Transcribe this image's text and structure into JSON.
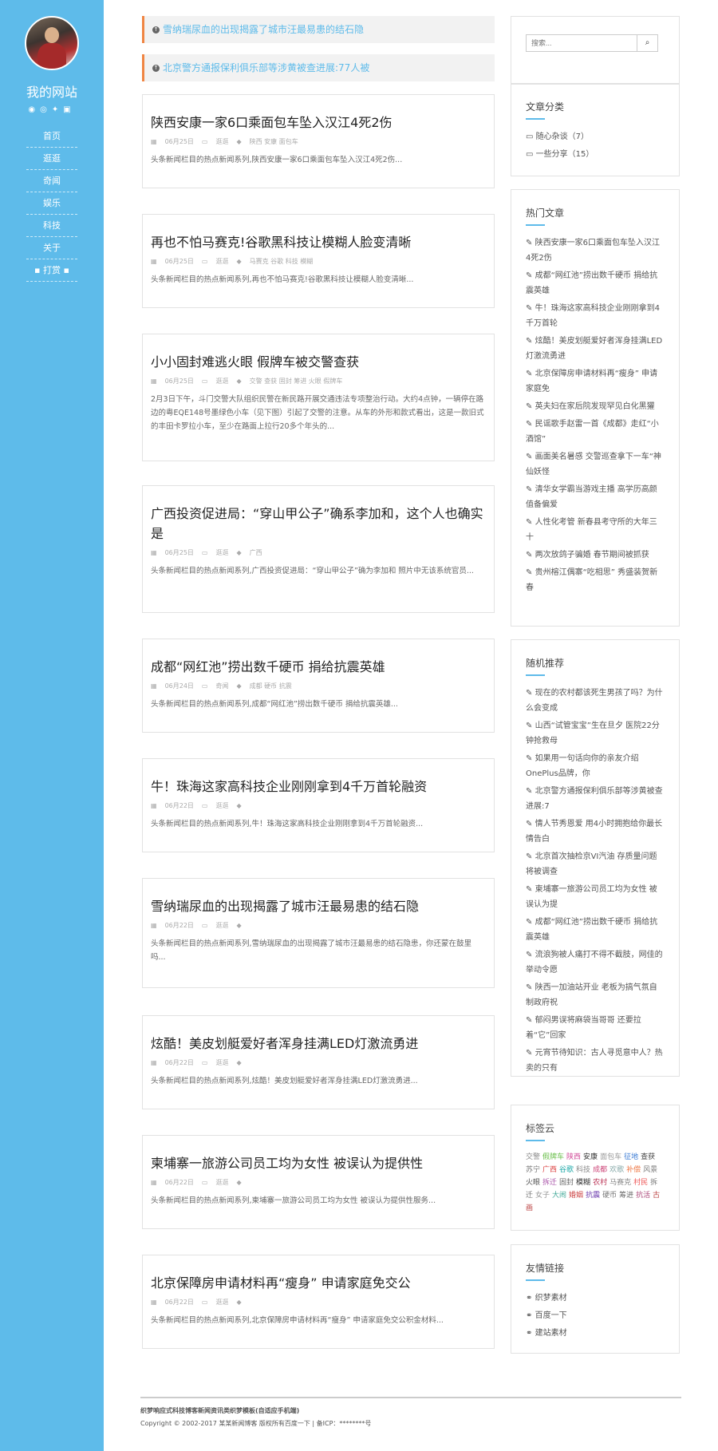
{
  "site": {
    "title": "我的网站",
    "social_icons": [
      "rss-icon",
      "weibo-icon",
      "twitter-icon",
      "facebook-icon"
    ],
    "nav": [
      "首页",
      "逛逛",
      "奇闻",
      "娱乐",
      "科技",
      "关于",
      "打赏"
    ]
  },
  "notices": [
    "雪纳瑞尿血的出现揭露了城市汪最易患的结石隐",
    "北京警方通报保利俱乐部等涉黄被查进展:77人被"
  ],
  "posts": [
    {
      "title": "陕西安康一家6口乘面包车坠入汉江4死2伤",
      "date": "06月25日",
      "cat": "逛逛",
      "tags": "陕西 安康 面包车",
      "excerpt": "头条新闻栏目的热点新闻系列,陕西安康一家6口乘面包车坠入汉江4死2伤..."
    },
    {
      "title": "再也不怕马赛克!谷歌黑科技让模糊人脸变清晰",
      "date": "06月25日",
      "cat": "逛逛",
      "tags": "马赛克 谷歌 科技 模糊",
      "excerpt": "头条新闻栏目的热点新闻系列,再也不怕马赛克!谷歌黑科技让模糊人脸变清晰..."
    },
    {
      "title": "小小固封难逃火眼 假牌车被交警查获",
      "date": "06月25日",
      "cat": "逛逛",
      "tags": "交警 查获 固封 筹进 火眼 假牌车",
      "excerpt": "2月3日下午，斗门交警大队组织民警在新民路开展交通违法专项整治行动。大约4点钟，一辆停在路边的粤EQE148号墨绿色小车（见下图）引起了交警的注意。从车的外形和款式看出，这是一款旧式的丰田卡罗拉小车，至少在路面上拉行20多个年头的..."
    },
    {
      "title": "广西投资促进局：“穿山甲公子”确系李加和，这个人也确实是",
      "date": "06月25日",
      "cat": "逛逛",
      "tags": "广西",
      "excerpt": "头条新闻栏目的热点新闻系列,广西投资促进局：“穿山甲公子”确为李加和 照片中无该系统官员..."
    },
    {
      "title": "成都“网红池”捞出数千硬币 捐给抗震英雄",
      "date": "06月24日",
      "cat": "奇闻",
      "tags": "成都 硬币 抗震",
      "excerpt": "头条新闻栏目的热点新闻系列,成都“网红池”捞出数千硬币 捐给抗震英雄..."
    },
    {
      "title": "牛！珠海这家高科技企业刚刚拿到4千万首轮融资",
      "date": "06月22日",
      "cat": "逛逛",
      "tags": "",
      "excerpt": "头条新闻栏目的热点新闻系列,牛！珠海这家高科技企业刚刚拿到4千万首轮融资..."
    },
    {
      "title": "雪纳瑞尿血的出现揭露了城市汪最易患的结石隐",
      "date": "06月22日",
      "cat": "逛逛",
      "tags": "",
      "excerpt": "头条新闻栏目的热点新闻系列,雪纳瑞尿血的出现揭露了城市汪最易患的结石隐患，你还蒙在鼓里吗..."
    },
    {
      "title": "炫酷！美皮划艇爱好者浑身挂满LED灯激流勇进",
      "date": "06月22日",
      "cat": "逛逛",
      "tags": "",
      "excerpt": "头条新闻栏目的热点新闻系列,炫酷！美皮划艇爱好者浑身挂满LED灯激流勇进..."
    },
    {
      "title": "柬埔寨一旅游公司员工均为女性 被误认为提供性",
      "date": "06月22日",
      "cat": "逛逛",
      "tags": "",
      "excerpt": "头条新闻栏目的热点新闻系列,柬埔寨一旅游公司员工均为女性 被误认为提供性服务..."
    },
    {
      "title": "北京保障房申请材料再“瘦身” 申请家庭免交公",
      "date": "06月22日",
      "cat": "逛逛",
      "tags": "",
      "excerpt": "头条新闻栏目的热点新闻系列,北京保障房申请材料再“瘦身” 申请家庭免交公积金材料..."
    }
  ],
  "sidebar": {
    "search_placeholder": "搜索...",
    "categories_title": "文章分类",
    "categories": [
      "随心杂谈（7）",
      "一些分享（15）"
    ],
    "hot_title": "热门文章",
    "hot": [
      "陕西安康一家6口乘面包车坠入汉江4死2伤",
      "成都“网红池”捞出数千硬币 捐给抗震英雄",
      "牛！珠海这家高科技企业刚刚拿到4千万首轮",
      "炫酷！美皮划艇爱好者浑身挂满LED灯激流勇进",
      "北京保障房申请材料再“瘦身” 申请家庭免",
      "英夫妇在家后院发现罕见白化黑獾",
      "民谣歌手赵雷一首《成都》走红“小酒馆”",
      "画面美名暑感 交警巡查拿下一车“神仙妖怪",
      "清华女学霸当游戏主播 高学历高颜值备偏爱",
      "人性化考管 新春县考守所的大年三十",
      "两次放鸽子骗婚 春节期间被抓获",
      "贵州榕江偶寨“吃相思” 秀盛装贺新春"
    ],
    "random_title": "随机推荐",
    "random": [
      "现在的农村都该死生男孩了吗？为什么会变成",
      "山西“试管宝宝”生在旦夕 医院22分钟抢救母",
      "如果用一句话向你的亲友介绍OnePlus品牌，你",
      "北京警方通报保利俱乐部等涉黄被查进展:7",
      "情人节秀恩爱 用4小时拥抱给你最长情告白",
      "北京首次抽检京VI汽油 存质量问题将被调查",
      "柬埔寨一旅游公司员工均为女性 被误认为提",
      "成都“网红池”捞出数千硬币 捐给抗震英雄",
      "流浪狗被人痛打不得不截肢，网佳的举动令愿",
      "陕西一加油站开业 老板为搞气氛自制政府祝",
      "郁闷男误将麻袋当哥哥 还要拉着“它”回家",
      "元宵节待知识：古人寻觅意中人？热卖的只有"
    ],
    "tags_title": "标签云",
    "tags": [
      {
        "t": "交警",
        "c": "#8a8a8a"
      },
      {
        "t": "假牌车",
        "c": "#6abf4b"
      },
      {
        "t": "陕西",
        "c": "#d24d9a"
      },
      {
        "t": "安康",
        "c": "#333"
      },
      {
        "t": "面包车",
        "c": "#999"
      },
      {
        "t": "征地",
        "c": "#3a7bd5"
      },
      {
        "t": "查获",
        "c": "#444"
      },
      {
        "t": "苏宁",
        "c": "#777"
      },
      {
        "t": "广西",
        "c": "#d44"
      },
      {
        "t": "谷歌",
        "c": "#2aa"
      },
      {
        "t": "科技",
        "c": "#888"
      },
      {
        "t": "成都",
        "c": "#c47"
      },
      {
        "t": "欢歌",
        "c": "#8aa"
      },
      {
        "t": "补偿",
        "c": "#e74"
      },
      {
        "t": "风景",
        "c": "#777"
      },
      {
        "t": "火眼",
        "c": "#555"
      },
      {
        "t": "拆迁",
        "c": "#a5a"
      },
      {
        "t": "固封",
        "c": "#666"
      },
      {
        "t": "模糊",
        "c": "#333"
      },
      {
        "t": "农村",
        "c": "#b35"
      },
      {
        "t": "马赛克",
        "c": "#888"
      },
      {
        "t": "村民",
        "c": "#e55"
      },
      {
        "t": "拆迁",
        "c": "#777"
      },
      {
        "t": "女子",
        "c": "#999"
      },
      {
        "t": "大闹",
        "c": "#4a9"
      },
      {
        "t": "婚姻",
        "c": "#c44"
      },
      {
        "t": "抗震",
        "c": "#63a"
      },
      {
        "t": "硬币",
        "c": "#777"
      },
      {
        "t": "筹进",
        "c": "#666"
      },
      {
        "t": "抗活",
        "c": "#a47"
      },
      {
        "t": "古画",
        "c": "#b44"
      }
    ],
    "links_title": "友情链接",
    "links": [
      "织梦素材",
      "百度一下",
      "建站素材"
    ]
  },
  "footer": {
    "line1": "织梦响应式科技博客新闻资讯类织梦模板(自适应手机端)",
    "line2": "Copyright © 2002-2017 某某新闻博客 版权所有百度一下 | 备ICP：********号"
  }
}
